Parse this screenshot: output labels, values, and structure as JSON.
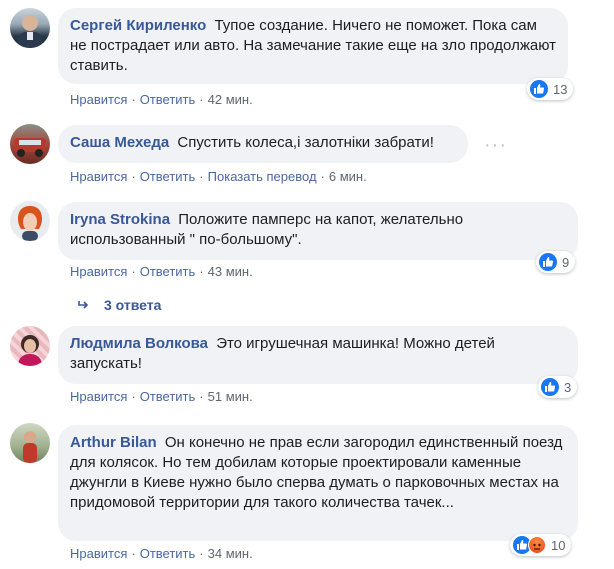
{
  "comments": [
    {
      "author": "Сергей Кириленко",
      "text": "Тупое создание. Ничего не поможет. Пока сам не пострадает или авто. На замечание такие еще на зло продолжают ставить.",
      "like_label": "Нравится",
      "reply_label": "Ответить",
      "time": "42 мин.",
      "reactions_count": "13"
    },
    {
      "author": "Саша Мехеда",
      "text": "Спустить колеса,і залотніки забрати!",
      "like_label": "Нравится",
      "reply_label": "Ответить",
      "translate_label": "Показать перевод",
      "time": "6 мин."
    },
    {
      "author": "Iryna Strokina",
      "text": "Положите памперс на капот, желательно использованный \" по-большому\".",
      "like_label": "Нравится",
      "reply_label": "Ответить",
      "time": "43 мин.",
      "reactions_count": "9",
      "replies_label": "3 ответа"
    },
    {
      "author": "Людмила Волкова",
      "text": "Это игрушечная машинка! Можно детей запускать!",
      "like_label": "Нравится",
      "reply_label": "Ответить",
      "time": "51 мин.",
      "reactions_count": "3"
    },
    {
      "author": "Arthur Bilan",
      "text": "Он конечно не прав если загородил единственный поезд для колясок. Но тем добилам которые проектировали каменные джунгли в Киеве нужно было сперва думать о парковочных местах на придомовой территории для такого количества тачек...",
      "like_label": "Нравится",
      "reply_label": "Ответить",
      "time": "34 мин.",
      "reactions_count": "10"
    }
  ],
  "colors": {
    "author": "#385898",
    "bubble": "#f0f2f5",
    "like": "#1877f2",
    "angry": "#e9421c"
  },
  "icons": {
    "more_options": "horizontal-dots-icon",
    "replies": "reply-arrow-icon",
    "like": "thumbs-up-icon",
    "angry": "angry-face-icon"
  }
}
